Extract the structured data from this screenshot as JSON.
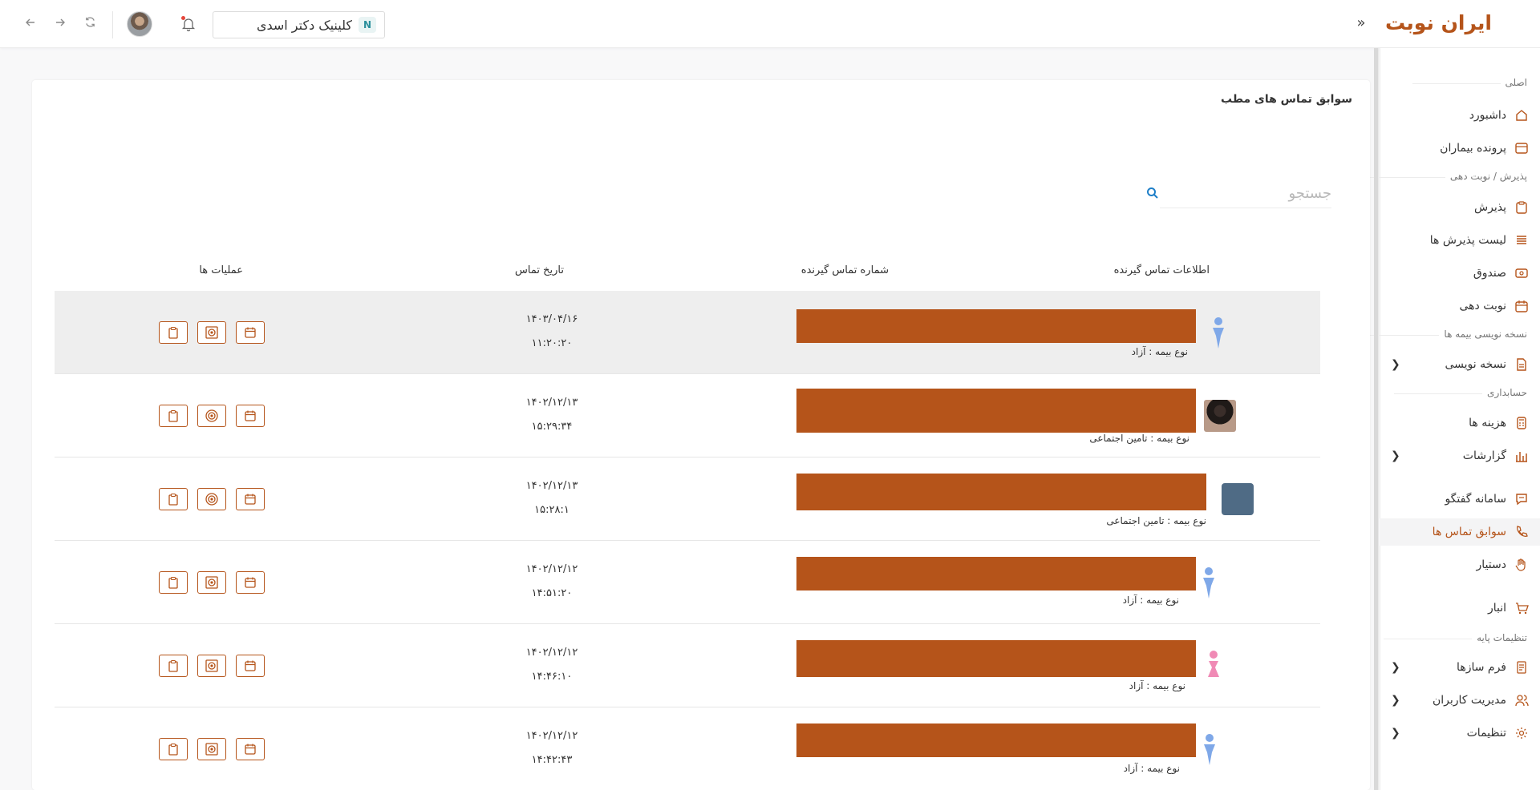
{
  "header": {
    "brand": "ایران نوبت",
    "clinic_name": "کلینیک دکتر اسدی",
    "clinic_logo": "N"
  },
  "sidebar": {
    "sections": {
      "main": "اصلی",
      "reception": "پذیرش / نوبت دهی",
      "prescription": "نسخه نویسی بیمه ها",
      "accounting": "حسابداری",
      "base_settings": "تنظیمات پایه"
    },
    "items": [
      {
        "label": "داشبورد",
        "icon": "home-icon"
      },
      {
        "label": "پرونده بیماران",
        "icon": "folder-icon"
      },
      {
        "label": "پذیرش",
        "icon": "clipboard-icon"
      },
      {
        "label": "لیست پذیرش ها",
        "icon": "list-icon"
      },
      {
        "label": "صندوق",
        "icon": "cash-icon"
      },
      {
        "label": "نوبت دهی",
        "icon": "calendar-icon"
      },
      {
        "label": "نسخه نویسی",
        "icon": "file-icon"
      },
      {
        "label": "هزینه ها",
        "icon": "calculator-icon"
      },
      {
        "label": "گزارشات",
        "icon": "chart-icon"
      },
      {
        "label": "سامانه گفتگو",
        "icon": "chat-icon"
      },
      {
        "label": "سوابق تماس ها",
        "icon": "phone-icon"
      },
      {
        "label": "دستیار",
        "icon": "hand-icon"
      },
      {
        "label": "انبار",
        "icon": "cart-icon"
      },
      {
        "label": "فرم سازها",
        "icon": "forms-icon"
      },
      {
        "label": "مدیریت کاربران",
        "icon": "users-icon"
      },
      {
        "label": "تنظیمات",
        "icon": "gear-icon"
      }
    ]
  },
  "page": {
    "title": "سوابق تماس های مطب",
    "search_placeholder": "جستجو"
  },
  "table": {
    "headers": {
      "caller_info": "اطلاعات تماس گیرنده",
      "caller_number": "شماره تماس گیرنده",
      "call_date": "تاریخ تماس",
      "operations": "عملیات ها"
    },
    "rows": [
      {
        "insurance": "نوع بیمه : آزاد",
        "date": "۱۴۰۳/۰۴/۱۶",
        "time": "۱۱:۲۰:۲۰",
        "avatar": "male-icon"
      },
      {
        "insurance": "نوع بیمه : تامین اجتماعی",
        "date": "۱۴۰۲/۱۲/۱۳",
        "time": "۱۵:۲۹:۳۴",
        "avatar": "photo"
      },
      {
        "insurance": "نوع بیمه : تامین اجتماعی",
        "date": "۱۴۰۲/۱۲/۱۳",
        "time": "۱۵:۲۸:۱",
        "avatar": "blank"
      },
      {
        "insurance": "نوع بیمه : آزاد",
        "date": "۱۴۰۲/۱۲/۱۲",
        "time": "۱۴:۵۱:۲۰",
        "avatar": "male-icon"
      },
      {
        "insurance": "نوع بیمه : آزاد",
        "date": "۱۴۰۲/۱۲/۱۲",
        "time": "۱۴:۴۶:۱۰",
        "avatar": "female-icon"
      },
      {
        "insurance": "نوع بیمه : آزاد",
        "date": "۱۴۰۲/۱۲/۱۲",
        "time": "۱۴:۴۲:۴۳",
        "avatar": "male-icon"
      }
    ]
  },
  "colors": {
    "accent": "#b5541a",
    "male": "#7fa8e8",
    "female": "#f08ab5",
    "blank_avatar": "#4f6b85"
  }
}
